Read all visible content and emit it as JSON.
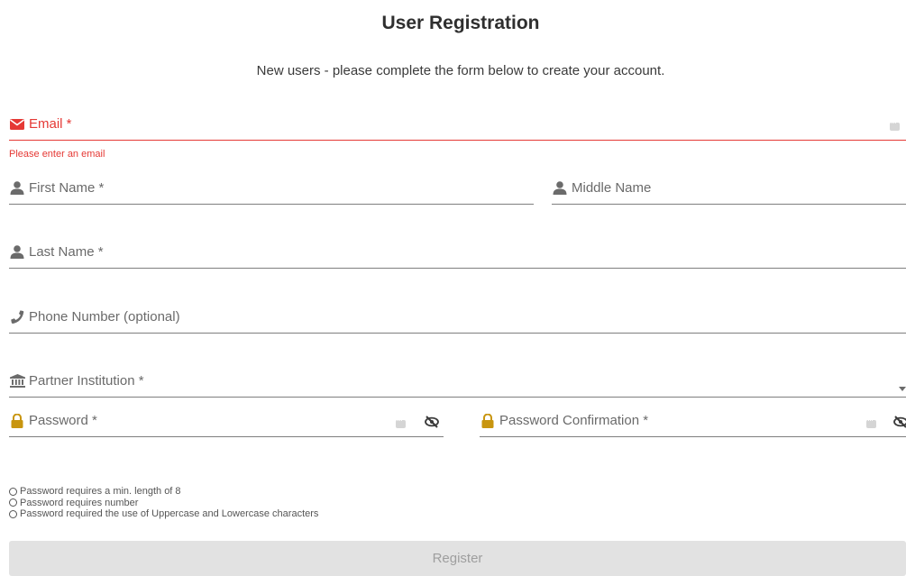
{
  "header": {
    "title": "User Registration",
    "subtitle": "New users - please complete the form below to create your account."
  },
  "fields": {
    "email": {
      "label": "Email *",
      "error": "Please enter an email",
      "icon": "envelope-icon"
    },
    "first_name": {
      "label": "First Name *",
      "icon": "user-icon"
    },
    "middle_name": {
      "label": "Middle Name",
      "icon": "user-icon"
    },
    "last_name": {
      "label": "Last Name *",
      "icon": "user-icon"
    },
    "phone": {
      "label": "Phone Number (optional)",
      "icon": "phone-icon"
    },
    "institution": {
      "label": "Partner Institution *",
      "icon": "bank-icon"
    },
    "password": {
      "label": "Password *",
      "icon": "lock-icon"
    },
    "password_confirmation": {
      "label": "Password Confirmation *",
      "icon": "lock-icon"
    }
  },
  "password_requirements": [
    "Password requires a min. length of 8",
    "Password requires number",
    "Password required the use of Uppercase and Lowercase characters"
  ],
  "actions": {
    "register_label": "Register"
  },
  "colors": {
    "error": "#e53935",
    "lock": "#c8950f",
    "button_bg": "#e2e2e2"
  }
}
